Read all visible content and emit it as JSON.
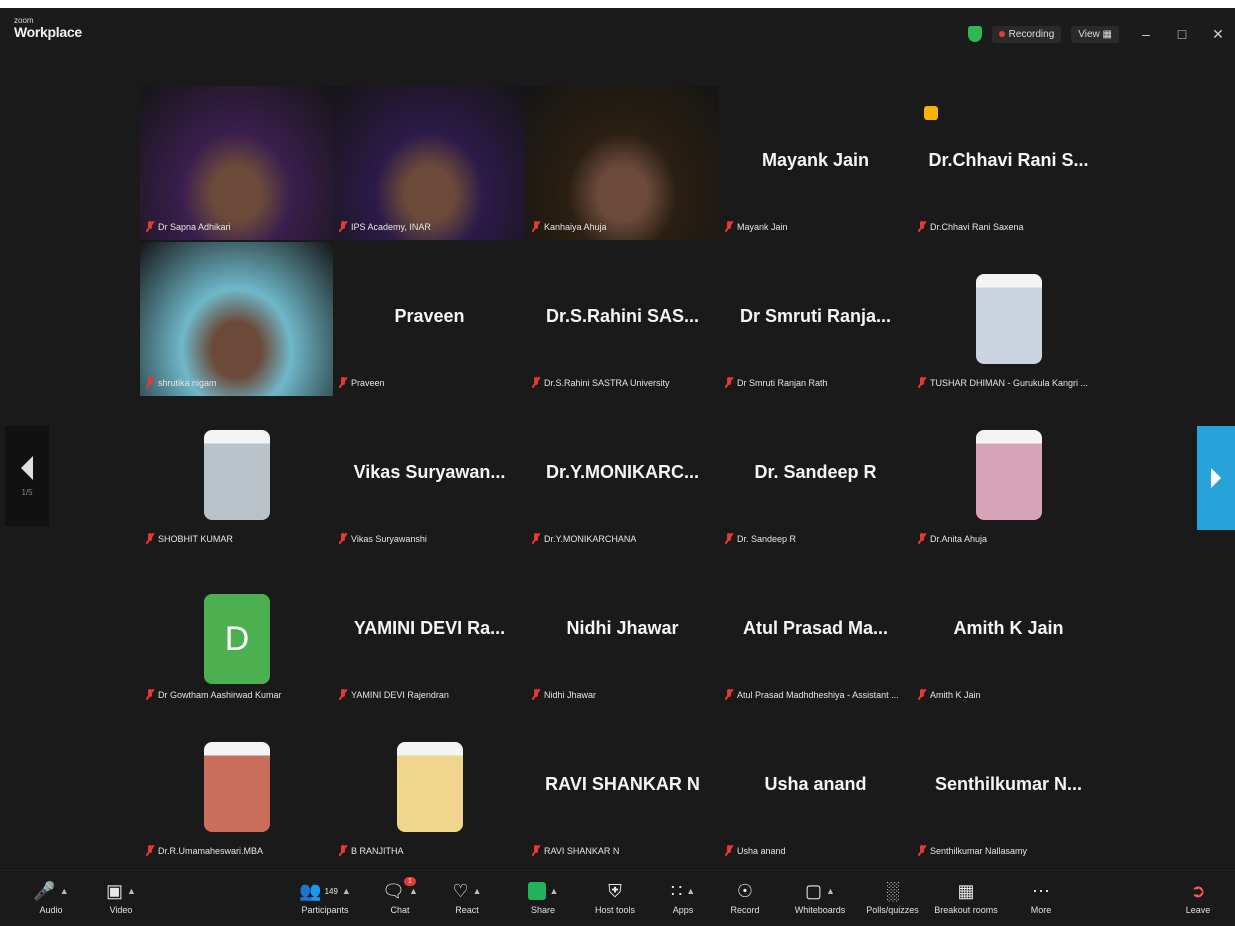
{
  "app": {
    "brand_small": "zoom",
    "brand_name": "Workplace",
    "recording_label": "Recording",
    "view_label": "View ▦",
    "minimize": "–",
    "maximize": "□",
    "close": "✕"
  },
  "nav": {
    "page_indicator": "1/5"
  },
  "tiles": [
    {
      "id": "sapna",
      "label": "Dr Sapna Adhikari",
      "type": "video",
      "bg": "#3a1e4e"
    },
    {
      "id": "ips",
      "label": "IPS Academy, INAR",
      "type": "video",
      "bg": "#2c1a48"
    },
    {
      "id": "kanhaiya",
      "label": "Kanhaiya Ahuja",
      "type": "video-active",
      "bg": "#2a1f12"
    },
    {
      "id": "mayank",
      "center_name": "Mayank Jain",
      "label": "Mayank Jain",
      "type": "name"
    },
    {
      "id": "chhavi",
      "center_name": "Dr.Chhavi Rani S...",
      "label": "Dr.Chhavi Rani Saxena",
      "type": "name-reaction"
    },
    {
      "id": "shrutika",
      "label": "shrutika nigam",
      "type": "video",
      "bg": "#6fb8c9"
    },
    {
      "id": "praveen",
      "center_name": "Praveen",
      "label": "Praveen",
      "type": "name"
    },
    {
      "id": "rahini",
      "center_name": "Dr.S.Rahini SAS...",
      "label": "Dr.S.Rahini SASTRA University",
      "type": "name"
    },
    {
      "id": "smruti",
      "center_name": "Dr Smruti Ranja...",
      "label": "Dr Smruti Ranjan Rath",
      "type": "name"
    },
    {
      "id": "tushar",
      "label": "TUSHAR DHIMAN - Gurukula Kangri ...",
      "type": "avatar",
      "bg": "#c9d4de"
    },
    {
      "id": "shobhit",
      "label": "SHOBHIT KUMAR",
      "type": "avatar",
      "bg": "#b8c2c8"
    },
    {
      "id": "vikas",
      "center_name": "Vikas Suryawan...",
      "label": "Vikas Suryawanshi",
      "type": "name"
    },
    {
      "id": "monikarc",
      "center_name": "Dr.Y.MONIKARC...",
      "label": "Dr.Y.MONIKARCHANA",
      "type": "name"
    },
    {
      "id": "sandeep",
      "center_name": "Dr. Sandeep R",
      "label": "Dr. Sandeep R",
      "type": "name"
    },
    {
      "id": "anita",
      "label": "Dr.Anita Ahuja",
      "type": "avatar",
      "bg": "#d7a3b8"
    },
    {
      "id": "gowtham",
      "letter": "D",
      "label": "Dr Gowtham Aashirwad Kumar",
      "type": "letter"
    },
    {
      "id": "yamini",
      "center_name": "YAMINI DEVI Ra...",
      "label": "YAMINI DEVI Rajendran",
      "type": "name"
    },
    {
      "id": "nidhi",
      "center_name": "Nidhi Jhawar",
      "label": "Nidhi Jhawar",
      "type": "name"
    },
    {
      "id": "atul",
      "center_name": "Atul Prasad Ma...",
      "label": "Atul Prasad Madhdheshiya - Assistant ...",
      "type": "name"
    },
    {
      "id": "amith",
      "center_name": "Amith K Jain",
      "label": "Amith K Jain",
      "type": "name"
    },
    {
      "id": "umamaheswari",
      "label": "Dr.R.Umamaheswari.MBA",
      "type": "avatar",
      "bg": "#c86e5a"
    },
    {
      "id": "ranjitha",
      "label": "B RANJITHA",
      "type": "avatar",
      "bg": "#f0d68c"
    },
    {
      "id": "ravi",
      "center_name": "RAVI SHANKAR N",
      "label": "RAVI SHANKAR N",
      "type": "name"
    },
    {
      "id": "usha",
      "center_name": "Usha anand",
      "label": "Usha anand",
      "type": "name"
    },
    {
      "id": "senthil",
      "center_name": "Senthilkumar N...",
      "label": "Senthilkumar Nallasamy",
      "type": "name"
    }
  ],
  "toolbar": {
    "audio": "Audio",
    "video": "Video",
    "participants": "Participants",
    "participants_count": "149",
    "chat": "Chat",
    "chat_badge": "1",
    "react": "React",
    "share": "Share",
    "host_tools": "Host tools",
    "apps": "Apps",
    "record": "Record",
    "whiteboards": "Whiteboards",
    "polls": "Polls/quizzes",
    "breakout": "Breakout rooms",
    "more": "More",
    "leave": "Leave"
  },
  "colors": {
    "background": "#1a1a1a",
    "active_speaker": "#23c552",
    "nav_right": "#27a3d9",
    "muted_mic": "#e53935",
    "avatar_green": "#4caf50"
  }
}
